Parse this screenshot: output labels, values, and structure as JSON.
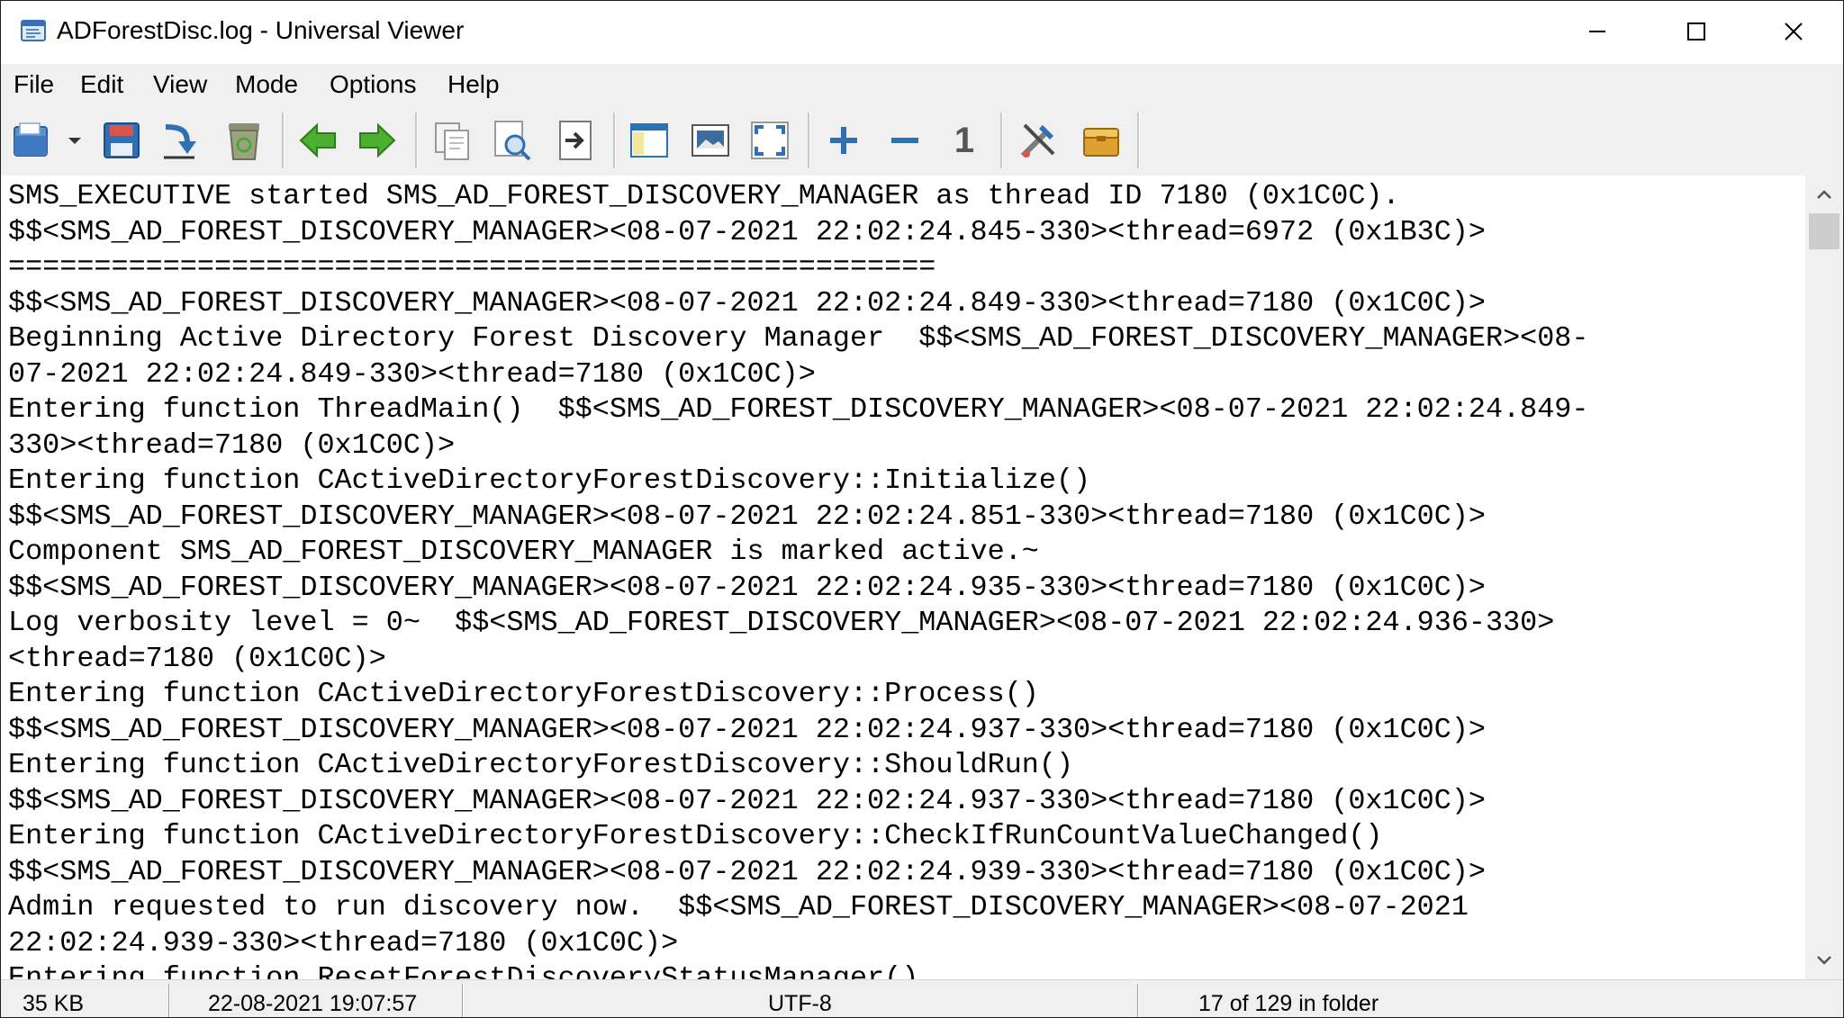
{
  "window": {
    "title": "ADForestDisc.log - Universal Viewer",
    "controls": [
      "minimize",
      "maximize",
      "close"
    ]
  },
  "menu": [
    "File",
    "Edit",
    "View",
    "Mode",
    "Options",
    "Help"
  ],
  "toolbar": {
    "buttons": [
      {
        "name": "open-icon"
      },
      {
        "name": "dropdown-arrow-icon"
      },
      {
        "name": "save-icon"
      },
      {
        "name": "move-icon"
      },
      {
        "name": "recycle-bin-icon"
      },
      {
        "name": "previous-file-icon"
      },
      {
        "name": "next-file-icon"
      },
      {
        "name": "copy-icon"
      },
      {
        "name": "find-icon"
      },
      {
        "name": "print-icon"
      },
      {
        "name": "panel-icon"
      },
      {
        "name": "image-icon"
      },
      {
        "name": "fullscreen-icon"
      },
      {
        "name": "zoom-in-icon"
      },
      {
        "name": "zoom-out-icon"
      },
      {
        "name": "original-size-icon"
      },
      {
        "name": "tools-icon"
      },
      {
        "name": "plugins-icon"
      }
    ],
    "original_size_label": "1"
  },
  "content": {
    "lines": [
      "SMS_EXECUTIVE started SMS_AD_FOREST_DISCOVERY_MANAGER as thread ID 7180 (0x1C0C).",
      "$$<SMS_AD_FOREST_DISCOVERY_MANAGER><08-07-2021 22:02:24.845-330><thread=6972 (0x1B3C)>",
      "======================================================",
      "$$<SMS_AD_FOREST_DISCOVERY_MANAGER><08-07-2021 22:02:24.849-330><thread=7180 (0x1C0C)>",
      "Beginning Active Directory Forest Discovery Manager  $$<SMS_AD_FOREST_DISCOVERY_MANAGER><08-",
      "07-2021 22:02:24.849-330><thread=7180 (0x1C0C)>",
      "Entering function ThreadMain()  $$<SMS_AD_FOREST_DISCOVERY_MANAGER><08-07-2021 22:02:24.849-",
      "330><thread=7180 (0x1C0C)>",
      "Entering function CActiveDirectoryForestDiscovery::Initialize()",
      "$$<SMS_AD_FOREST_DISCOVERY_MANAGER><08-07-2021 22:02:24.851-330><thread=7180 (0x1C0C)>",
      "Component SMS_AD_FOREST_DISCOVERY_MANAGER is marked active.~",
      "$$<SMS_AD_FOREST_DISCOVERY_MANAGER><08-07-2021 22:02:24.935-330><thread=7180 (0x1C0C)>",
      "Log verbosity level = 0~  $$<SMS_AD_FOREST_DISCOVERY_MANAGER><08-07-2021 22:02:24.936-330>",
      "<thread=7180 (0x1C0C)>",
      "Entering function CActiveDirectoryForestDiscovery::Process()",
      "$$<SMS_AD_FOREST_DISCOVERY_MANAGER><08-07-2021 22:02:24.937-330><thread=7180 (0x1C0C)>",
      "Entering function CActiveDirectoryForestDiscovery::ShouldRun()",
      "$$<SMS_AD_FOREST_DISCOVERY_MANAGER><08-07-2021 22:02:24.937-330><thread=7180 (0x1C0C)>",
      "Entering function CActiveDirectoryForestDiscovery::CheckIfRunCountValueChanged()",
      "$$<SMS_AD_FOREST_DISCOVERY_MANAGER><08-07-2021 22:02:24.939-330><thread=7180 (0x1C0C)>",
      "Admin requested to run discovery now.  $$<SMS_AD_FOREST_DISCOVERY_MANAGER><08-07-2021",
      "22:02:24.939-330><thread=7180 (0x1C0C)>",
      "Entering function ResetForestDiscoveryStatusManager()"
    ]
  },
  "status": {
    "size": "35 KB",
    "date": "22-08-2021 19:07:57",
    "encoding": "UTF-8",
    "position": "17 of 129 in folder"
  },
  "colors": {
    "chrome": "#f0f0f0",
    "arrow_green": "#3fa02f",
    "icon_blue": "#2f6fb4"
  }
}
